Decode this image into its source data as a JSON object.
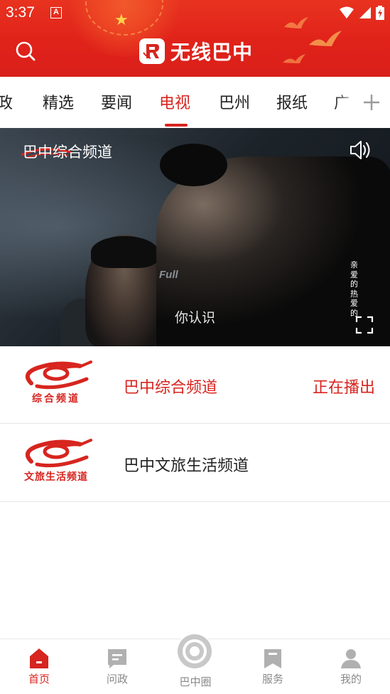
{
  "status_bar": {
    "time": "3:37",
    "notification_icon_letter": "A",
    "icons": [
      "wifi-icon",
      "signal-icon",
      "battery-icon"
    ]
  },
  "header": {
    "app_title": "无线巴中",
    "search_icon": "search-icon",
    "logo_icon": "app-logo-icon",
    "brand_color": "#e0221a"
  },
  "tabs": {
    "items": [
      {
        "label": "政"
      },
      {
        "label": "精选"
      },
      {
        "label": "要闻"
      },
      {
        "label": "电视"
      },
      {
        "label": "巴州"
      },
      {
        "label": "报纸"
      },
      {
        "label": "广"
      }
    ],
    "active_index": 3,
    "add_icon": "plus-icon",
    "active_color": "#d7251f"
  },
  "player": {
    "channel_title": "巴中综合频道",
    "subtitle": "你认识",
    "side_caption": "亲爱的 热爱的",
    "sound_icon": "speaker-icon",
    "fullscreen_icon": "fullscreen-icon"
  },
  "channels": [
    {
      "logo_text": "综合频道",
      "name": "巴中综合频道",
      "status": "正在播出"
    },
    {
      "logo_text": "文旅生活频道",
      "name": "巴中文旅生活频道",
      "status": ""
    }
  ],
  "bottom_nav": {
    "items": [
      {
        "label": "首页",
        "icon": "home-icon"
      },
      {
        "label": "问政",
        "icon": "message-icon"
      },
      {
        "label": "巴中圈",
        "icon": "circle-icon"
      },
      {
        "label": "服务",
        "icon": "bookmark-icon"
      },
      {
        "label": "我的",
        "icon": "user-icon"
      }
    ],
    "active_index": 0
  }
}
